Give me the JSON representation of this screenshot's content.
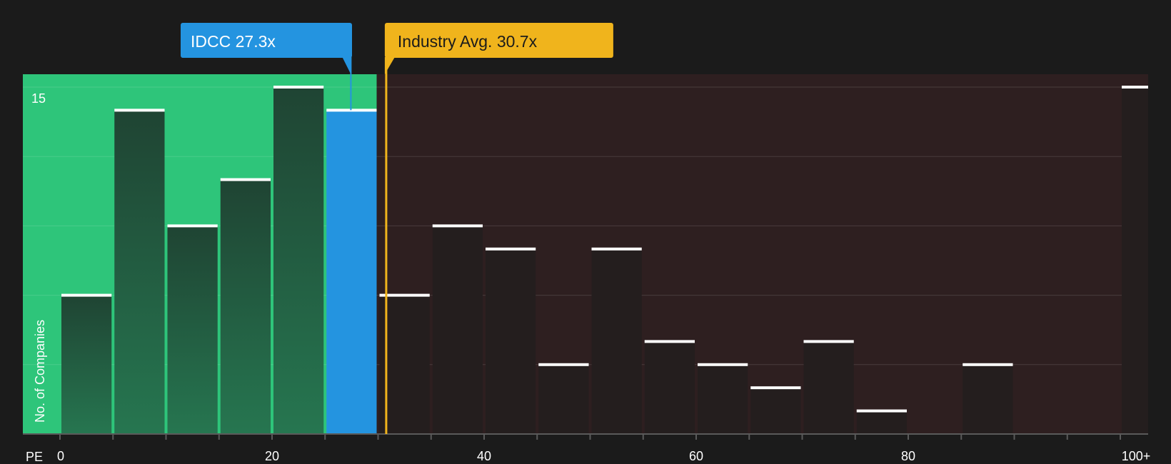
{
  "chart_data": {
    "type": "bar",
    "ylabel": "No. of Companies",
    "xlabel": "PE",
    "ylim": [
      0,
      16
    ],
    "y_tick_labels": [
      "15"
    ],
    "x_tick_labels": [
      "0",
      "20",
      "40",
      "60",
      "80",
      "100+"
    ],
    "bins": [
      {
        "start": 0,
        "end": 5,
        "value": 6
      },
      {
        "start": 5,
        "end": 10,
        "value": 14
      },
      {
        "start": 10,
        "end": 15,
        "value": 9
      },
      {
        "start": 15,
        "end": 20,
        "value": 11
      },
      {
        "start": 20,
        "end": 25,
        "value": 15
      },
      {
        "start": 25,
        "end": 30,
        "value": 14,
        "highlight": true
      },
      {
        "start": 30,
        "end": 35,
        "value": 6
      },
      {
        "start": 35,
        "end": 40,
        "value": 9
      },
      {
        "start": 40,
        "end": 45,
        "value": 8
      },
      {
        "start": 45,
        "end": 50,
        "value": 3
      },
      {
        "start": 50,
        "end": 55,
        "value": 8
      },
      {
        "start": 55,
        "end": 60,
        "value": 4
      },
      {
        "start": 60,
        "end": 65,
        "value": 3
      },
      {
        "start": 65,
        "end": 70,
        "value": 2
      },
      {
        "start": 70,
        "end": 75,
        "value": 4
      },
      {
        "start": 75,
        "end": 80,
        "value": 1
      },
      {
        "start": 80,
        "end": 85,
        "value": 0
      },
      {
        "start": 85,
        "end": 90,
        "value": 3
      },
      {
        "start": 90,
        "end": 95,
        "value": 0
      },
      {
        "start": 95,
        "end": 100,
        "value": 0
      },
      {
        "start": 100,
        "end": 102.5,
        "value": 15
      }
    ],
    "company": {
      "label": "IDCC 27.3x",
      "value": 27.3
    },
    "industry": {
      "label": "Industry Avg. 30.7x",
      "value": 30.7
    },
    "fair_range_max": 29.8
  },
  "colors": {
    "background": "#1b1b1b",
    "fair_zone": "#2ec57a",
    "high_zone": "#2e1f20",
    "company": "#2494e0",
    "industry": "#f0b41c",
    "bar_fair": "#1f4a36",
    "bar_high": "#241e1e",
    "cap": "#ffffff"
  }
}
